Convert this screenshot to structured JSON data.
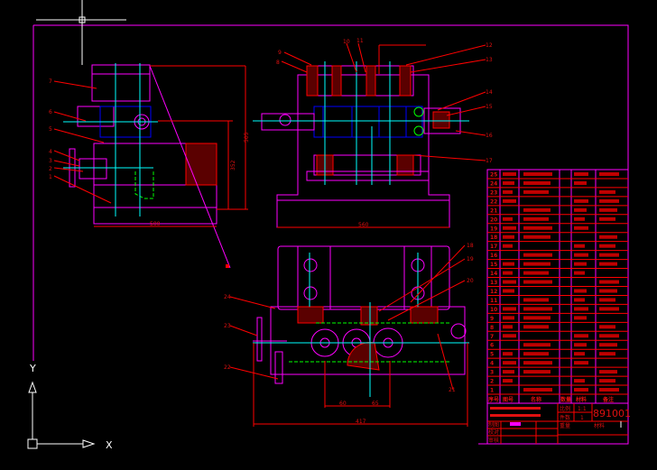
{
  "drawing": {
    "left_view_labels": [
      "1",
      "2",
      "3",
      "4",
      "5",
      "6",
      "7"
    ],
    "top_view_labels": [
      "8",
      "9",
      "10",
      "11",
      "12",
      "13",
      "14",
      "15",
      "16",
      "17"
    ],
    "bottom_view_labels": [
      "18",
      "19",
      "20",
      "21",
      "22",
      "23",
      "24"
    ],
    "dimensions": {
      "left_width": "500",
      "left_height_1": "352",
      "left_height_2": "505",
      "top_width": "560",
      "bottom_dim_1": "60",
      "bottom_dim_2": "65",
      "bottom_width": "417"
    }
  },
  "title_block": {
    "rows": [
      "25",
      "24",
      "23",
      "22",
      "21",
      "20",
      "19",
      "18",
      "17",
      "16",
      "15",
      "14",
      "13",
      "12",
      "11",
      "10",
      "9",
      "8",
      "7",
      "6",
      "5",
      "4",
      "3",
      "2",
      "1"
    ],
    "headers": {
      "index": "序号",
      "code": "图号",
      "name": "名称",
      "qty": "数量",
      "material": "材料",
      "note": "备注"
    },
    "scale_label": "比例",
    "scale_value": "1:1",
    "count_label": "件数",
    "count_value": "1",
    "weight_label": "重量",
    "material_label": "材料",
    "drawing_number": "891001",
    "drawn_label": "制图",
    "checked_label": "校对",
    "approved_label": "审核"
  },
  "colors": {
    "background": "#000000",
    "outline": "#ff00ff",
    "dimension": "#ff0000",
    "centerline": "#00ffff",
    "hidden": "#00ff00",
    "blue": "#0000ff",
    "cursor": "#ffffff"
  },
  "ucs": {
    "x_label": "X",
    "y_label": "Y"
  }
}
